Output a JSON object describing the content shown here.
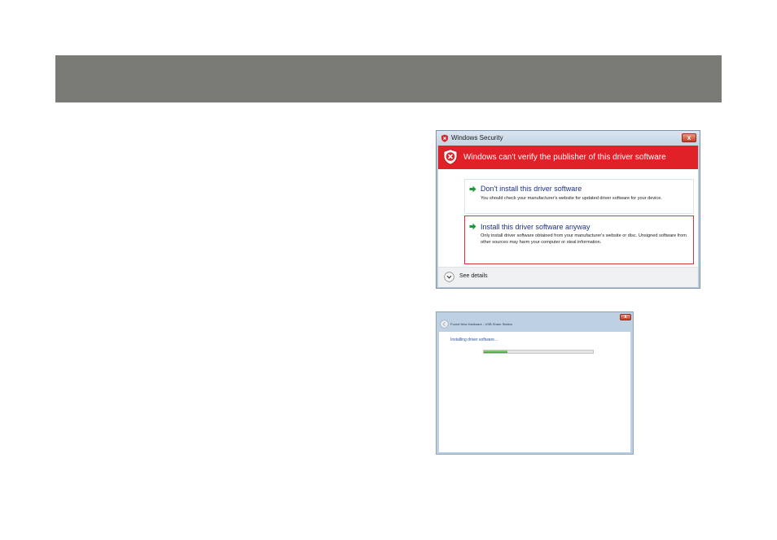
{
  "security_dialog": {
    "title": "Windows Security",
    "banner_text": "Windows can't verify the publisher of this driver software",
    "close_label": "x",
    "options": [
      {
        "title": "Don't install this driver software",
        "description": "You should check your manufacturer's website for updated driver software for your device."
      },
      {
        "title": "Install this driver software anyway",
        "description": "Only install driver software obtained from your manufacturer's website or disc. Unsigned software from other sources may harm your computer or steal information."
      }
    ],
    "see_details": "See details",
    "colors": {
      "banner": "#e12128",
      "option_title": "#1e3287",
      "highlight_border": "#d6333a",
      "arrow": "#1f9a3a"
    },
    "icons": [
      "shield-x-icon",
      "arrow-right-icon",
      "chevron-down-icon",
      "close-icon"
    ]
  },
  "hardware_dialog": {
    "title": "Found New Hardware - USB Share Station",
    "status_text": "Installing driver software...",
    "close_label": "x",
    "progress": 0.22,
    "colors": {
      "progress_fill": "#2aa52a",
      "status_text": "#2a5599"
    },
    "icons": [
      "back-arrow-icon",
      "close-icon"
    ]
  }
}
